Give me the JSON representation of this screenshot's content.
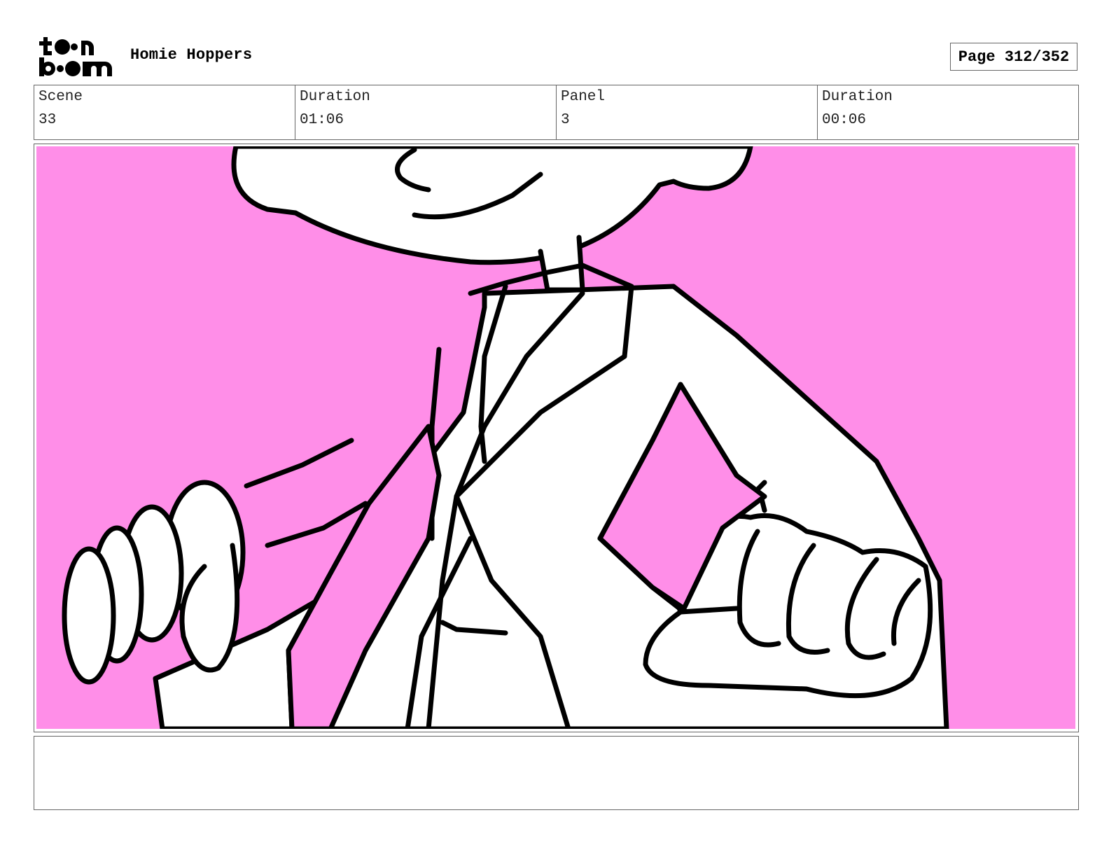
{
  "header": {
    "logo_text": "toon boom",
    "project_title": "Homie Hoppers",
    "page_label": "Page 312/352"
  },
  "info": {
    "scene_label": "Scene",
    "scene_value": "33",
    "scene_duration_label": "Duration",
    "scene_duration_value": "01:06",
    "panel_label": "Panel",
    "panel_value": "3",
    "panel_duration_label": "Duration",
    "panel_duration_value": "00:06"
  },
  "panel": {
    "background_color": "#ff8ee8",
    "line_color": "#000000",
    "fill_color": "#ffffff"
  },
  "notes": {
    "text": ""
  }
}
